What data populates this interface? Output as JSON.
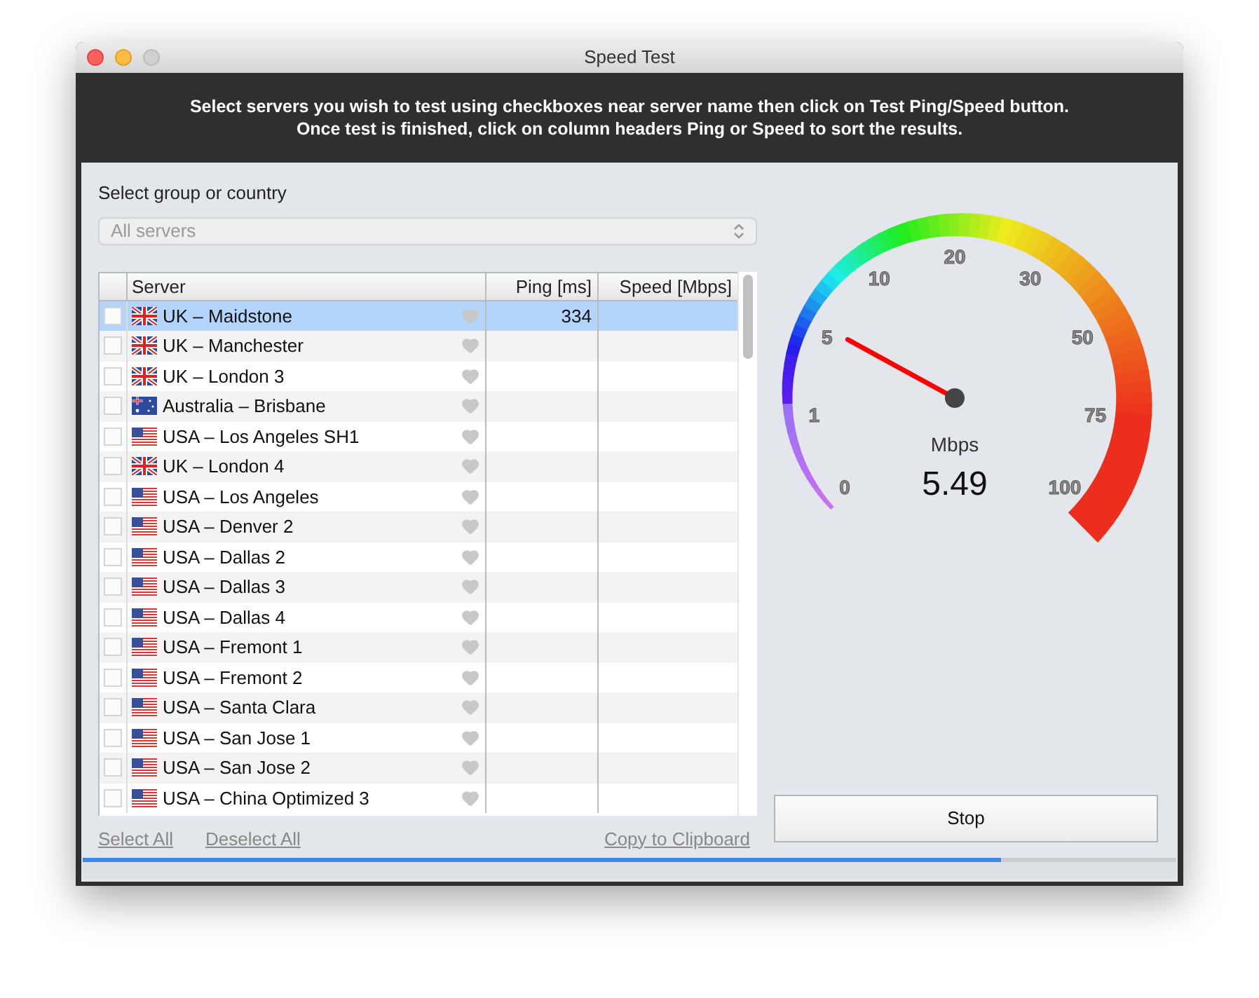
{
  "window": {
    "title": "Speed Test"
  },
  "instructions": [
    "Select servers you wish to test using checkboxes near server name then click on Test Ping/Speed button.",
    "Once test is finished, click on column headers Ping or Speed to sort the results."
  ],
  "group": {
    "label": "Select group or country",
    "value": "All servers",
    "disabled": true
  },
  "table": {
    "columns": [
      "Server",
      "Ping [ms]",
      "Speed [Mbps]"
    ],
    "rows": [
      {
        "server": "UK – Maidstone",
        "kind": "uk",
        "ping": "334",
        "selected": true,
        "checked": false
      },
      {
        "server": "UK – Manchester",
        "kind": "uk",
        "selected": false,
        "checked": false
      },
      {
        "server": "UK – London 3",
        "kind": "uk",
        "selected": false,
        "checked": false
      },
      {
        "server": "Australia – Brisbane",
        "kind": "au",
        "selected": false,
        "checked": false
      },
      {
        "server": "USA – Los Angeles SH1",
        "kind": "us",
        "selected": false,
        "checked": false
      },
      {
        "server": "UK – London 4",
        "kind": "uk",
        "selected": false,
        "checked": false
      },
      {
        "server": "USA – Los Angeles",
        "kind": "us",
        "selected": false,
        "checked": false
      },
      {
        "server": "USA – Denver 2",
        "kind": "us",
        "selected": false,
        "checked": false
      },
      {
        "server": "USA – Dallas 2",
        "kind": "us",
        "selected": false,
        "checked": false
      },
      {
        "server": "USA – Dallas 3",
        "kind": "us",
        "selected": false,
        "checked": false
      },
      {
        "server": "USA – Dallas 4",
        "kind": "us",
        "selected": false,
        "checked": false
      },
      {
        "server": "USA – Fremont 1",
        "kind": "us",
        "selected": false,
        "checked": false
      },
      {
        "server": "USA – Fremont 2",
        "kind": "us",
        "selected": false,
        "checked": false
      },
      {
        "server": "USA – Santa Clara",
        "kind": "us",
        "selected": false,
        "checked": false
      },
      {
        "server": "USA – San Jose 1",
        "kind": "us",
        "selected": false,
        "checked": false
      },
      {
        "server": "USA – San Jose 2",
        "kind": "us",
        "selected": false,
        "checked": false
      },
      {
        "server": "USA – China Optimized 3",
        "kind": "us",
        "selected": false,
        "checked": false
      }
    ]
  },
  "links": [
    "Select All",
    "Deselect All",
    "Copy to Clipboard"
  ],
  "gauge": {
    "ticks": [
      "0",
      "1",
      "5",
      "10",
      "20",
      "30",
      "50",
      "75",
      "100"
    ],
    "unit": "Mbps",
    "reading": "5.49"
  },
  "stop_button": "Stop",
  "progress": {
    "level": 0.84
  }
}
